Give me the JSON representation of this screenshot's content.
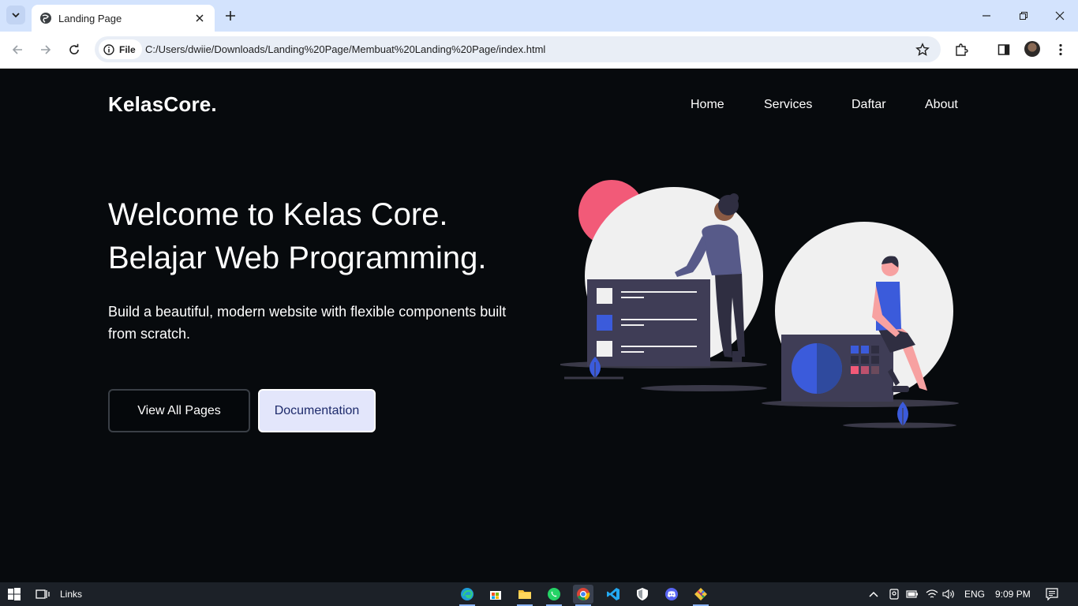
{
  "browser": {
    "tab_title": "Landing Page",
    "site_chip_label": "File",
    "url": "C:/Users/dwiie/Downloads/Landing%20Page/Membuat%20Landing%20Page/index.html"
  },
  "page": {
    "brand": "KelasCore.",
    "nav": [
      "Home",
      "Services",
      "Daftar",
      "About"
    ],
    "headline_line1": "Welcome to Kelas Core.",
    "headline_line2": "Belajar Web Programming.",
    "subtext": "Build a beautiful, modern website with flexible components built from scratch.",
    "buttons": {
      "primary": "View All Pages",
      "secondary": "Documentation"
    }
  },
  "colors": {
    "page_bg": "#070a0d",
    "accent_blue": "#3b5bdb",
    "accent_pink": "#f25a78",
    "button_light_bg": "#e3e6fb",
    "button_light_text": "#1d2a6b"
  },
  "taskbar": {
    "search_label": "Links",
    "language": "ENG",
    "time": "9:09 PM",
    "apps": [
      "edge-icon",
      "store-icon",
      "file-explorer-icon",
      "whatsapp-icon",
      "chrome-icon",
      "vscode-icon",
      "security-icon",
      "discord-icon",
      "git-icon"
    ]
  }
}
